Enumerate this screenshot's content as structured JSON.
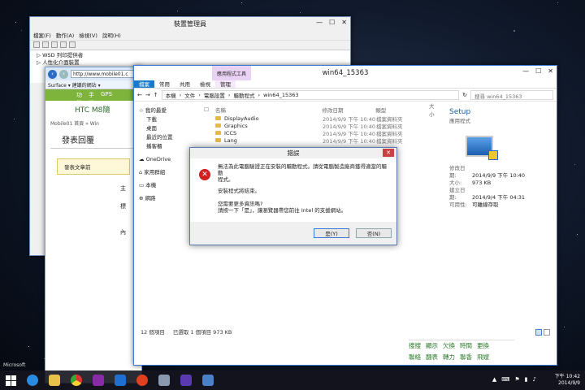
{
  "device_manager": {
    "title": "裝置管理員",
    "menu": [
      "檔案(F)",
      "動作(A)",
      "檢視(V)",
      "說明(H)"
    ],
    "tree": [
      "WSD 列印提供者",
      "人性化介面裝置"
    ]
  },
  "browser": {
    "url": "http://www.mobile01.c",
    "favorites": "Surface ▾  建議的網站 ▾",
    "site_tabs": [
      "功能",
      "手機",
      "GPS"
    ],
    "heading": "HTC M8隨",
    "breadcrumb": "Mobile01 首頁 » Win",
    "post_title": "發表回覆",
    "post_button": "發表文章前",
    "labels": [
      "主",
      "標",
      "內"
    ]
  },
  "explorer": {
    "title": "win64_15363",
    "context_tab": "應用程式工具",
    "ribbon_tabs": [
      "檔案",
      "常用",
      "共用",
      "檢視",
      "管理"
    ],
    "path": [
      "本機",
      "文件",
      "電腦設置",
      "驅動程式",
      "win64_15363"
    ],
    "search_placeholder": "搜尋 win64_15363",
    "nav": [
      "我的最愛",
      "下載",
      "桌面",
      "最近的位置",
      "播客櫃",
      "OneDrive",
      "家用群組",
      "本機",
      "網路"
    ],
    "columns": [
      "名稱",
      "修改日期",
      "類型",
      "大小"
    ],
    "files": [
      {
        "name": "DisplayAudio",
        "date": "2014/9/9 下午 10:40",
        "type": "檔案資料夾"
      },
      {
        "name": "Graphics",
        "date": "2014/9/9 下午 10:40",
        "type": "檔案資料夾"
      },
      {
        "name": "ICCS",
        "date": "2014/9/9 下午 10:40",
        "type": "檔案資料夾"
      },
      {
        "name": "Lang",
        "date": "2014/9/9 下午 10:40",
        "type": "檔案資料夾"
      }
    ],
    "detail_name": "Setup",
    "detail_type": "應用程式",
    "detail_rows": [
      {
        "k": "修改日期:",
        "v": "2014/9/9 下午 10:40"
      },
      {
        "k": "大小:",
        "v": "973 KB"
      },
      {
        "k": "建立日期:",
        "v": "2014/9/4 下午 04:31"
      },
      {
        "k": "可用性:",
        "v": "可離線存取"
      }
    ],
    "status_count": "12 個項目",
    "status_selected": "已選取 1 個項目  973 KB",
    "ime_row1": [
      "搜搜",
      "顯示",
      "欠換",
      "時間",
      "更換"
    ],
    "ime_row2": [
      "聯絡",
      "翻表",
      "轉力",
      "聯香",
      "飛嫂"
    ]
  },
  "dialog": {
    "title": "錯誤",
    "line1": "無法為此電腦驗證正在安裝的驅動程式。請從電腦製造廠商獲得適當的驅動",
    "line2": "程式。",
    "line3": "安裝程式將結束。",
    "line4": "您需要更多資訊嗎?",
    "line5": "請按一下「是」，讓瀏覽器帶您前往 Intel 的支援網站。",
    "yes": "是(Y)",
    "no": "否(N)"
  },
  "taskbar": {
    "time": "下午 10:42",
    "date": "2014/9/9",
    "watermark": "Microsoft"
  },
  "colors": {
    "accent": "#1979ca",
    "site_green": "#7eb43b",
    "error_red": "#d02020"
  }
}
